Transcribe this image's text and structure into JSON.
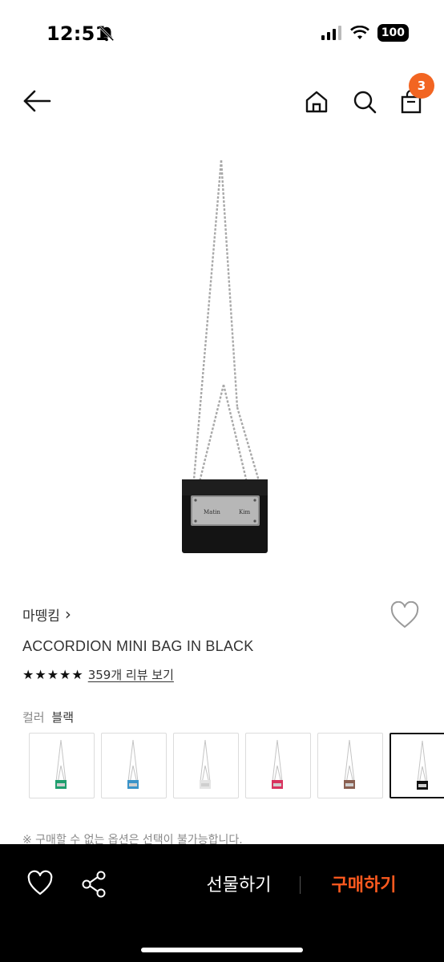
{
  "status_bar": {
    "time": "12:51",
    "battery": "100",
    "icons": [
      "bell-slash-icon",
      "cellular-signal-icon",
      "wifi-icon",
      "battery-icon"
    ]
  },
  "nav": {
    "icons": [
      "back-arrow-icon",
      "home-icon",
      "search-icon",
      "shopping-bag-icon"
    ],
    "cart_count": "3",
    "badge_color": "#f26522"
  },
  "product": {
    "brand": "마뗑킴",
    "brand_chevron": "›",
    "name": "ACCORDION MINI BAG IN BLACK",
    "rating_stars": 5,
    "review_text": "359개 리뷰 보기",
    "image_plate_text_left": "Matin",
    "image_plate_text_right": "Kim"
  },
  "color_option": {
    "label": "컬러",
    "value": "블랙",
    "swatches": [
      {
        "name": "green",
        "color": "#1f9e6e"
      },
      {
        "name": "blue",
        "color": "#3a93c8"
      },
      {
        "name": "white",
        "color": "#e4e4e4"
      },
      {
        "name": "pink",
        "color": "#d8345f"
      },
      {
        "name": "brown",
        "color": "#8a6052"
      },
      {
        "name": "black",
        "color": "#111111"
      }
    ],
    "selected_index": 5
  },
  "notice": "※ 구매할 수 없는 옵션은 선택이 불가능합니다.",
  "bottom_bar": {
    "gift_label": "선물하기",
    "buy_label": "구매하기",
    "buy_color": "#ff5a1f",
    "icons": [
      "heart-icon",
      "share-icon"
    ]
  }
}
